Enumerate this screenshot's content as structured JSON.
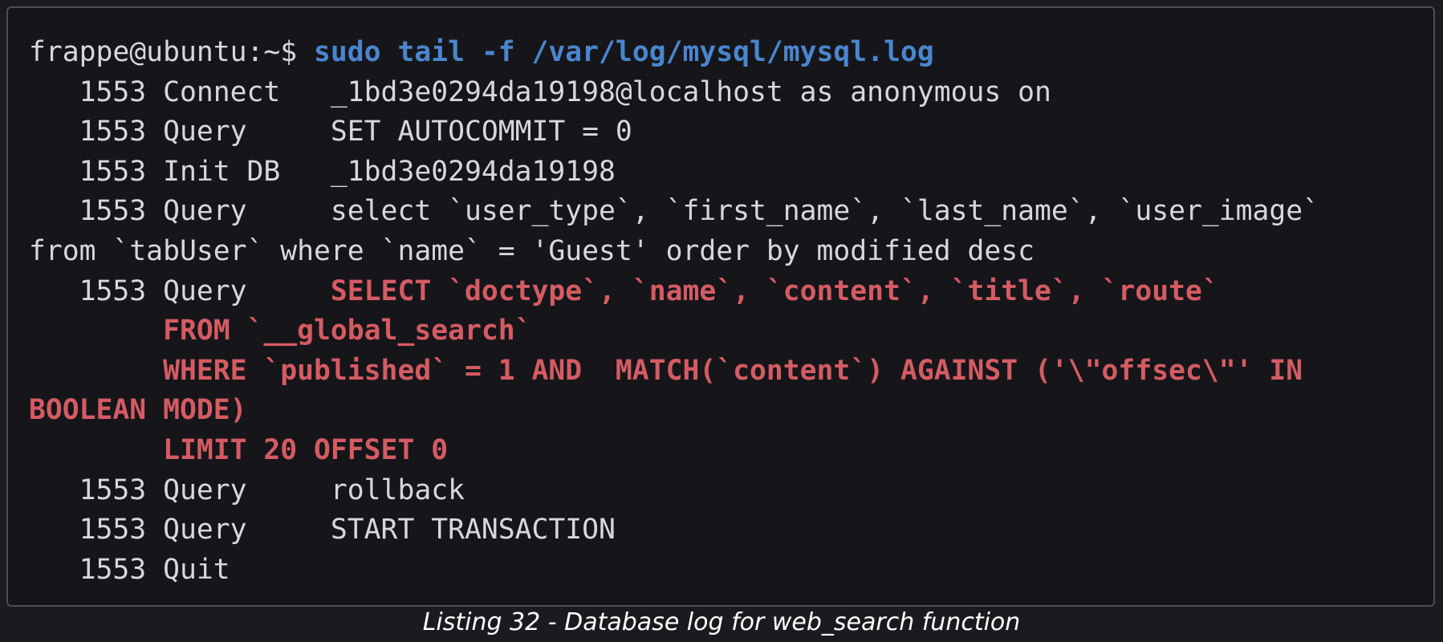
{
  "terminal": {
    "prompt": "frappe@ubuntu:~$ ",
    "command": "sudo tail -f /var/log/mysql/mysql.log",
    "lines": {
      "l1": "   1553 Connect   _1bd3e0294da19198@localhost as anonymous on",
      "l2": "   1553 Query     SET AUTOCOMMIT = 0",
      "l3": "   1553 Init DB   _1bd3e0294da19198",
      "l4": "   1553 Query     select `user_type`, `first_name`, `last_name`, `user_image`",
      "l5": "from `tabUser` where `name` = 'Guest' order by modified desc",
      "l6_prefix": "   1553 Query     ",
      "l6_sql": "SELECT `doctype`, `name`, `content`, `title`, `route`",
      "l7_sql": "        FROM `__global_search`",
      "l8_sql": "        WHERE `published` = 1 AND  MATCH(`content`) AGAINST ('\\\"offsec\\\"' IN",
      "l9_sql": "BOOLEAN MODE)",
      "l10_sql": "        LIMIT 20 OFFSET 0",
      "l11": "   1553 Query     rollback",
      "l12": "   1553 Query     START TRANSACTION",
      "l13": "   1553 Quit"
    }
  },
  "caption": "Listing 32 - Database log for web_search function",
  "colors": {
    "background": "#16161a",
    "text": "#d8d8dc",
    "command": "#4a86cf",
    "highlight_sql": "#d55b63"
  }
}
